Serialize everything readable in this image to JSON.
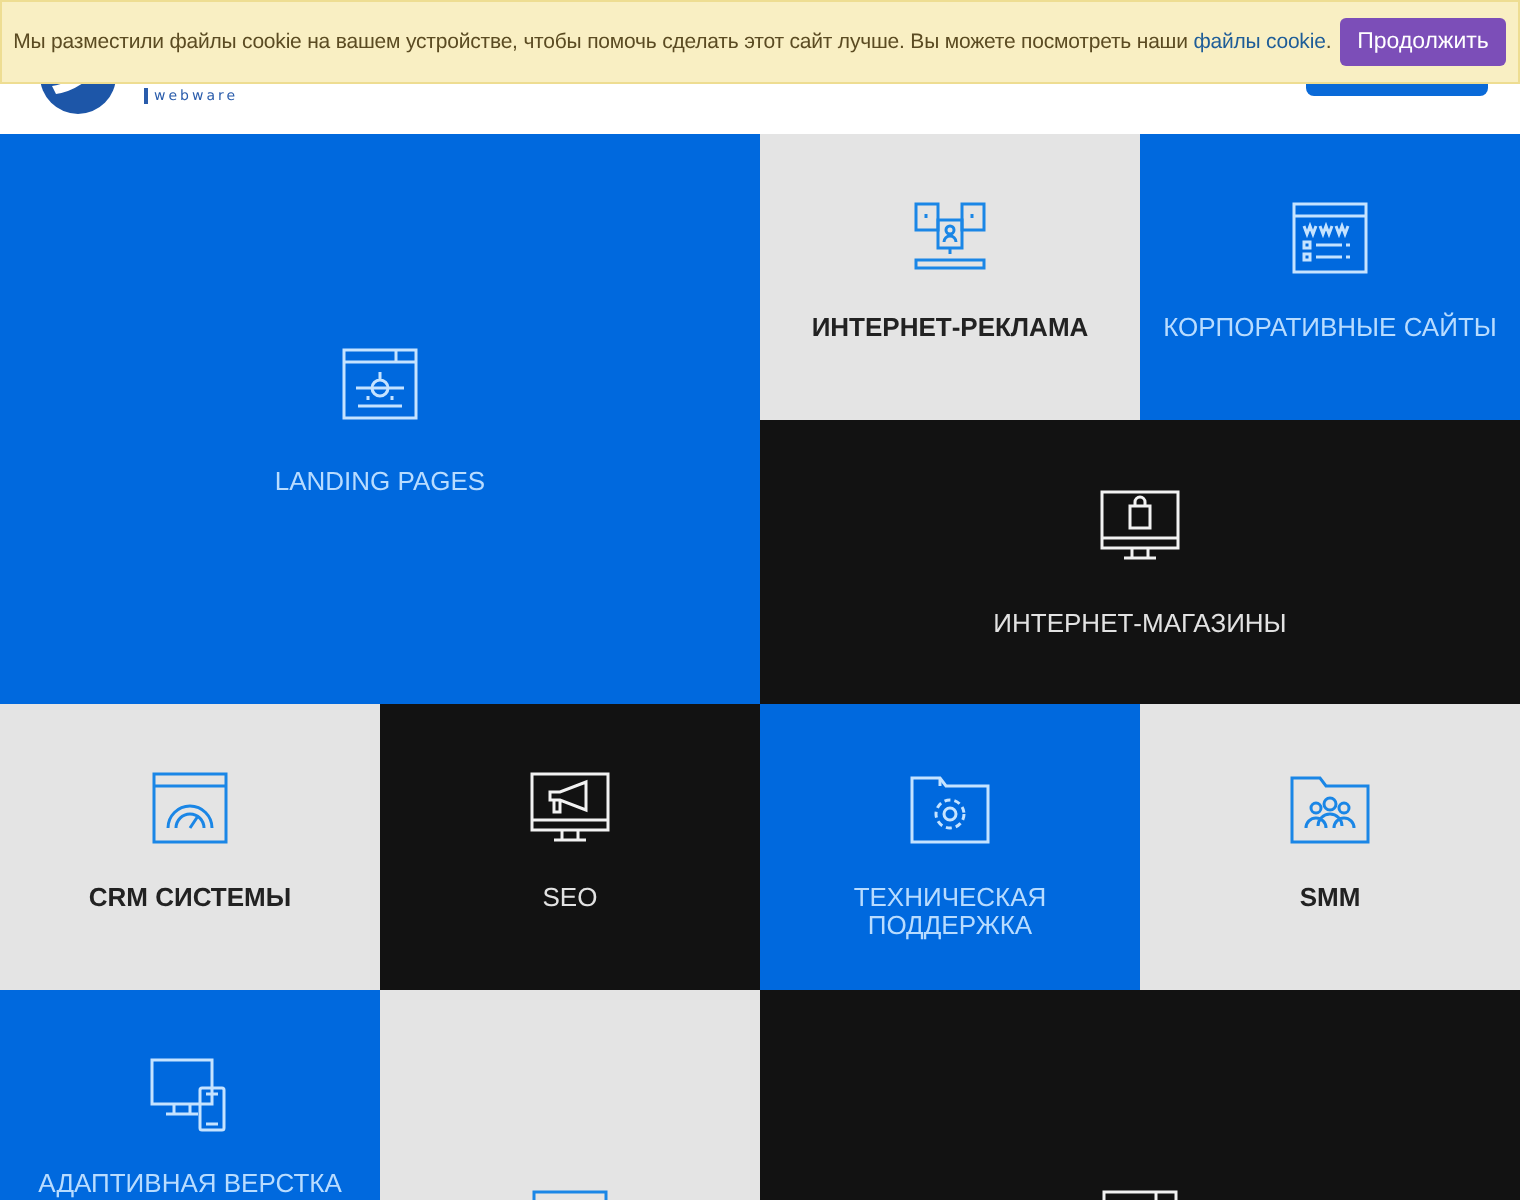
{
  "cookie_banner": {
    "text": "Мы разместили файлы cookie на вашем устройстве, чтобы помочь сделать этот сайт лучше. Вы можете посмотреть наши ",
    "link": "файлы cookie",
    "text_after": ".",
    "button": "Продолжить"
  },
  "header": {
    "logo_text": "webware"
  },
  "tiles": [
    {
      "label": "LANDING PAGES",
      "color": "#0069de",
      "kind": "big"
    },
    {
      "label": "ИНТЕРНЕТ-РЕКЛАМА",
      "color": "#e4e4e4",
      "kind": "small"
    },
    {
      "label": "КОРПОРАТИВНЫЕ САЙТЫ",
      "color": "#0069de",
      "kind": "small"
    },
    {
      "label": "ИНТЕРНЕТ-МАГАЗИНЫ",
      "color": "#121212",
      "kind": "wide"
    },
    {
      "label": "CRM СИСТЕМЫ",
      "color": "#e4e4e4",
      "kind": "small"
    },
    {
      "label": "SEO",
      "color": "#121212",
      "kind": "small"
    },
    {
      "label": "ТЕХНИЧЕСКАЯ ПОДДЕРЖКА",
      "color": "#0069de",
      "kind": "small"
    },
    {
      "label": "SMM",
      "color": "#e4e4e4",
      "kind": "small"
    },
    {
      "label": "АДАПТИВНАЯ ВЕРСТКА",
      "color": "#0069de",
      "kind": "small"
    },
    {
      "color": "#e4e4e4",
      "kind": "tall"
    },
    {
      "color": "#121212",
      "kind": "big"
    }
  ]
}
